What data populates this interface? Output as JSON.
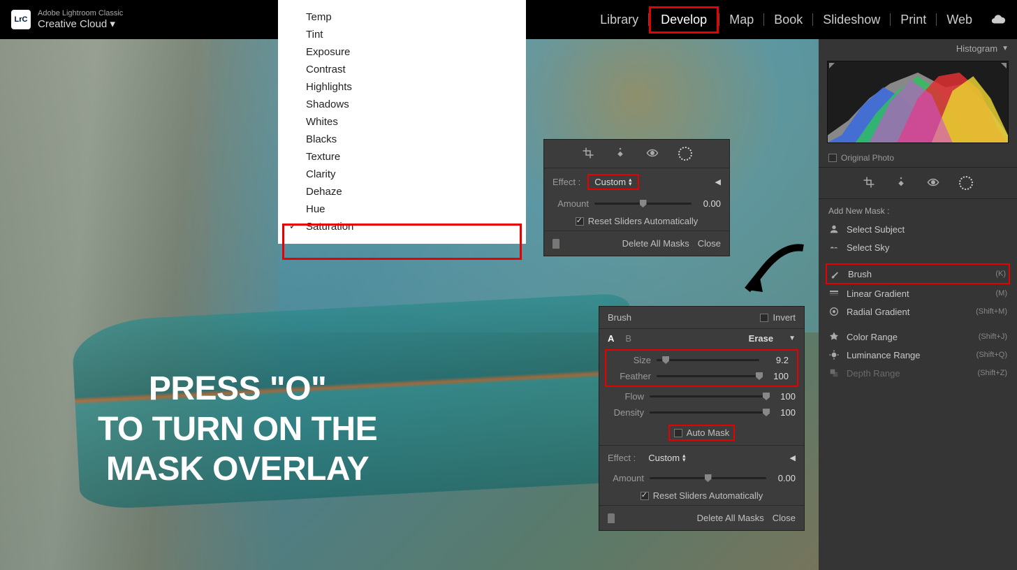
{
  "app": {
    "title": "Adobe Lightroom Classic",
    "subtitle": "Creative Cloud"
  },
  "modules": [
    "Library",
    "Develop",
    "Map",
    "Book",
    "Slideshow",
    "Print",
    "Web"
  ],
  "active_module": "Develop",
  "dropdown": [
    "Temp",
    "Tint",
    "Exposure",
    "Contrast",
    "Highlights",
    "Shadows",
    "Whites",
    "Blacks",
    "Texture",
    "Clarity",
    "Dehaze",
    "Hue",
    "Saturation"
  ],
  "dropdown_checked": "Saturation",
  "panel1": {
    "effect_label": "Effect :",
    "effect_value": "Custom",
    "amount_label": "Amount",
    "amount_value": "0.00",
    "amount_pct": 50,
    "reset_label": "Reset Sliders Automatically",
    "delete_label": "Delete All Masks",
    "close_label": "Close"
  },
  "panel2": {
    "title": "Brush",
    "invert_label": "Invert",
    "a": "A",
    "b": "B",
    "erase": "Erase",
    "sliders": [
      {
        "label": "Size",
        "value": "9.2",
        "pct": 9
      },
      {
        "label": "Feather",
        "value": "100",
        "pct": 100
      },
      {
        "label": "Flow",
        "value": "100",
        "pct": 100
      },
      {
        "label": "Density",
        "value": "100",
        "pct": 100
      }
    ],
    "automask_label": "Auto Mask",
    "effect_label": "Effect :",
    "effect_value": "Custom",
    "amount_label": "Amount",
    "amount_value": "0.00",
    "amount_pct": 50,
    "reset_label": "Reset Sliders Automatically",
    "delete_label": "Delete All Masks",
    "close_label": "Close"
  },
  "right": {
    "histogram_label": "Histogram",
    "original_label": "Original Photo",
    "add_mask_label": "Add New Mask :",
    "masks": [
      {
        "label": "Select Subject",
        "key": ""
      },
      {
        "label": "Select Sky",
        "key": ""
      },
      {
        "label": "Brush",
        "key": "(K)"
      },
      {
        "label": "Linear Gradient",
        "key": "(M)"
      },
      {
        "label": "Radial Gradient",
        "key": "(Shift+M)"
      },
      {
        "label": "Color Range",
        "key": "(Shift+J)"
      },
      {
        "label": "Luminance Range",
        "key": "(Shift+Q)"
      },
      {
        "label": "Depth Range",
        "key": "(Shift+Z)"
      }
    ]
  },
  "annotation": {
    "line1": "PRESS \"O\"",
    "line2": "TO TURN ON THE",
    "line3": "MASK OVERLAY"
  }
}
